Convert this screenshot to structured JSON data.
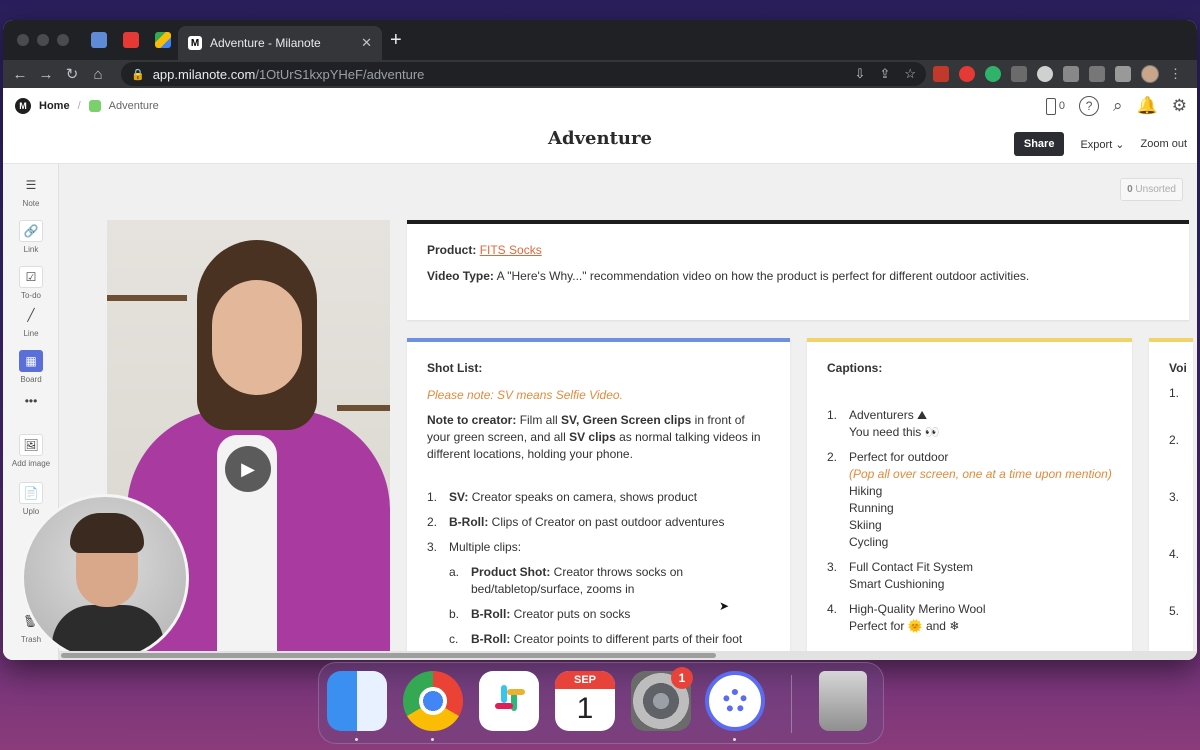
{
  "browser": {
    "tab_title": "Adventure - Milanote",
    "tab_favicon": "M",
    "url_host": "app.milanote.com",
    "url_path": "/1OtUrS1kxpYHeF/adventure",
    "new_tab_glyph": "+",
    "close_glyph": "✕"
  },
  "breadcrumb": {
    "home": "Home",
    "current": "Adventure"
  },
  "header": {
    "title": "Adventure",
    "device_count": "0",
    "share": "Share",
    "export": "Export ⌄",
    "zoom": "Zoom out"
  },
  "toolbox": [
    {
      "label": "Note",
      "icon": "☰"
    },
    {
      "label": "Link",
      "icon": "🔗"
    },
    {
      "label": "To-do",
      "icon": "☑"
    },
    {
      "label": "Line",
      "icon": "╱"
    },
    {
      "label": "Board",
      "icon": "▦"
    },
    {
      "label": "",
      "icon": "•••"
    },
    {
      "label": "Add image",
      "icon": "🖼"
    },
    {
      "label": "Uplo",
      "icon": "📄"
    },
    {
      "label": "Trash",
      "icon": "🗑"
    }
  ],
  "unsorted": {
    "count": "0",
    "label": "Unsorted"
  },
  "product_card": {
    "product_label": "Product:",
    "product_value": "FITS Socks",
    "video_label": "Video Type:",
    "video_value": "A \"Here's Why...\" recommendation video on how the product is perfect for different outdoor activities."
  },
  "shot_list": {
    "title": "Shot List:",
    "note": "Please note: SV means Selfie Video.",
    "creator_label": "Note to creator:",
    "creator_p1": "Film all",
    "creator_b1": "SV, Green Screen clips",
    "creator_p2": "in front of your green screen, and all",
    "creator_b2": "SV clips",
    "creator_p3": "as normal talking videos in different locations, holding your phone.",
    "items": [
      {
        "n": "1.",
        "b": "SV:",
        "t": "Creator speaks on camera, shows product"
      },
      {
        "n": "2.",
        "b": "B-Roll:",
        "t": "Clips of Creator on past outdoor adventures"
      },
      {
        "n": "3.",
        "b": "",
        "t": "Multiple clips:"
      }
    ],
    "subitems": [
      {
        "n": "a.",
        "b": "Product Shot:",
        "t": "Creator throws socks on bed/tabletop/surface, zooms in"
      },
      {
        "n": "b.",
        "b": "B-Roll:",
        "t": "Creator puts on socks"
      },
      {
        "n": "c.",
        "b": "B-Roll:",
        "t": "Creator points to different parts of their foot"
      }
    ]
  },
  "captions": {
    "title": "Captions:",
    "items": [
      {
        "n": "1.",
        "lines": [
          "Adventurers ⛰",
          "You need this 👀"
        ],
        "note": ""
      },
      {
        "n": "2.",
        "lines": [
          "Perfect for outdoor"
        ],
        "note": "(Pop all over screen, one at a time upon mention)",
        "extra": [
          "Hiking",
          "Running",
          "Skiing",
          "Cycling"
        ]
      },
      {
        "n": "3.",
        "lines": [
          "Full Contact Fit System",
          "Smart Cushioning"
        ],
        "note": ""
      },
      {
        "n": "4.",
        "lines": [
          "High-Quality Merino Wool",
          "Perfect for 🌞 and ❄"
        ],
        "note": ""
      }
    ]
  },
  "voice": {
    "title": "Voi",
    "nums": [
      "1.",
      "2.",
      "3.",
      "4.",
      "5."
    ]
  },
  "dock": {
    "calendar_month": "SEP",
    "calendar_day": "1",
    "settings_badge": "1"
  }
}
